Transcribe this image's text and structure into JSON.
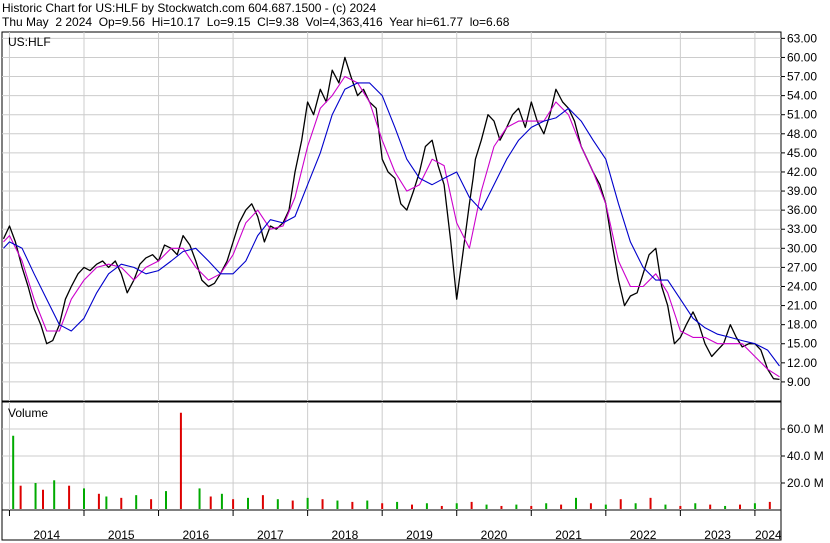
{
  "header": {
    "line1": "Historic Chart for US:HLF by Stockwatch.com 604.687.1500 - (c) 2024",
    "line2": "Thu May  2 2024  Op=9.56  Hi=10.17  Lo=9.15  Cl=9.38  Vol=4,363,416  Year hi=61.77  lo=6.68"
  },
  "colors": {
    "price": "#000000",
    "ma_short": "#cc00cc",
    "ma_long": "#0000cc",
    "vol_up": "#00aa00",
    "vol_down": "#dd0000",
    "grid": "#cccccc"
  },
  "chart_data": {
    "type": "line",
    "symbol_label": "US:HLF",
    "volume_label": "Volume",
    "x_ticks": [
      "2014",
      "2015",
      "2016",
      "2017",
      "2018",
      "2019",
      "2020",
      "2021",
      "2022",
      "2023",
      "2024"
    ],
    "price_axis": {
      "ylim": [
        6,
        64
      ],
      "ticks": [
        9,
        12,
        15,
        18,
        21,
        24,
        27,
        30,
        33,
        36,
        39,
        42,
        45,
        48,
        51,
        54,
        57,
        60,
        63
      ],
      "tick_labels": [
        "9.00",
        "12.00",
        "15.00",
        "18.00",
        "21.00",
        "24.00",
        "27.00",
        "30.00",
        "33.00",
        "36.00",
        "39.00",
        "42.00",
        "45.00",
        "48.00",
        "51.00",
        "54.00",
        "57.00",
        "60.00",
        "63.00"
      ]
    },
    "volume_axis": {
      "ylim": [
        0,
        80
      ],
      "ticks": [
        20,
        40,
        60
      ],
      "tick_labels": [
        "20.0 M",
        "40.0 M",
        "60.0 M"
      ]
    },
    "series": [
      {
        "name": "Close",
        "x": [
          2013.92,
          2014.0,
          2014.08,
          2014.17,
          2014.25,
          2014.33,
          2014.42,
          2014.5,
          2014.58,
          2014.67,
          2014.75,
          2014.83,
          2014.92,
          2015.0,
          2015.08,
          2015.17,
          2015.25,
          2015.33,
          2015.42,
          2015.5,
          2015.58,
          2015.67,
          2015.75,
          2015.83,
          2015.92,
          2016.0,
          2016.08,
          2016.17,
          2016.25,
          2016.33,
          2016.42,
          2016.5,
          2016.58,
          2016.67,
          2016.75,
          2016.83,
          2016.92,
          2017.0,
          2017.08,
          2017.17,
          2017.25,
          2017.33,
          2017.42,
          2017.5,
          2017.58,
          2017.67,
          2017.75,
          2017.83,
          2017.92,
          2018.0,
          2018.08,
          2018.17,
          2018.25,
          2018.33,
          2018.42,
          2018.5,
          2018.58,
          2018.67,
          2018.75,
          2018.83,
          2018.92,
          2019.0,
          2019.08,
          2019.17,
          2019.25,
          2019.33,
          2019.42,
          2019.5,
          2019.58,
          2019.67,
          2019.75,
          2019.83,
          2019.92,
          2020.0,
          2020.08,
          2020.17,
          2020.22,
          2020.25,
          2020.33,
          2020.42,
          2020.5,
          2020.58,
          2020.67,
          2020.75,
          2020.83,
          2020.92,
          2021.0,
          2021.08,
          2021.17,
          2021.25,
          2021.33,
          2021.42,
          2021.5,
          2021.58,
          2021.67,
          2021.75,
          2021.83,
          2021.92,
          2022.0,
          2022.08,
          2022.17,
          2022.25,
          2022.33,
          2022.42,
          2022.5,
          2022.58,
          2022.67,
          2022.75,
          2022.83,
          2022.92,
          2023.0,
          2023.08,
          2023.17,
          2023.25,
          2023.33,
          2023.42,
          2023.5,
          2023.58,
          2023.67,
          2023.75,
          2023.83,
          2023.92,
          2024.0,
          2024.08,
          2024.17,
          2024.25,
          2024.33
        ],
        "values": [
          31.5,
          33.5,
          31,
          27,
          24,
          20.5,
          18,
          15,
          15.5,
          18,
          22,
          24,
          26,
          27,
          26.5,
          27.5,
          28,
          27,
          28,
          26,
          23,
          25,
          27.5,
          28.5,
          29,
          28,
          30.5,
          30,
          29,
          32,
          30.5,
          28,
          25,
          24,
          24.5,
          26,
          28,
          31,
          34,
          36,
          37,
          35,
          31,
          33.5,
          33,
          34,
          36,
          42,
          47,
          53,
          51,
          55,
          53,
          58,
          56,
          60,
          57,
          54,
          55,
          53,
          52,
          44,
          42,
          41,
          37,
          36,
          39,
          42,
          46,
          47,
          43,
          40,
          31,
          22,
          29,
          37,
          41,
          44,
          47,
          51,
          50,
          47,
          49,
          51,
          52,
          49,
          53,
          50,
          48,
          51,
          55,
          53,
          52,
          50,
          46,
          44,
          42,
          40,
          37,
          31,
          25,
          21,
          22.5,
          23,
          26,
          29,
          30,
          24,
          21,
          15,
          16,
          18,
          20,
          18,
          15,
          13,
          14,
          15,
          18,
          16,
          14.5,
          15,
          15,
          14,
          11,
          9.5,
          9.4
        ]
      },
      {
        "name": "",
        "x": [
          2013.92,
          2014.0,
          2014.17,
          2014.33,
          2014.5,
          2014.67,
          2014.83,
          2015.0,
          2015.17,
          2015.33,
          2015.5,
          2015.67,
          2015.83,
          2016.0,
          2016.17,
          2016.33,
          2016.5,
          2016.67,
          2016.83,
          2017.0,
          2017.17,
          2017.33,
          2017.5,
          2017.67,
          2017.83,
          2018.0,
          2018.17,
          2018.33,
          2018.5,
          2018.67,
          2018.83,
          2019.0,
          2019.17,
          2019.33,
          2019.5,
          2019.67,
          2019.83,
          2020.0,
          2020.17,
          2020.33,
          2020.5,
          2020.67,
          2020.83,
          2021.0,
          2021.17,
          2021.33,
          2021.5,
          2021.67,
          2021.83,
          2022.0,
          2022.17,
          2022.33,
          2022.5,
          2022.67,
          2022.83,
          2023.0,
          2023.17,
          2023.33,
          2023.5,
          2023.67,
          2023.83,
          2024.0,
          2024.17,
          2024.33
        ],
        "values": [
          31,
          32,
          28,
          22,
          17,
          17,
          22,
          25,
          27,
          27.5,
          27,
          25,
          27,
          28,
          30,
          30,
          27,
          25,
          26,
          29,
          34,
          36,
          33,
          33.5,
          38,
          46,
          52,
          54,
          57,
          56,
          53,
          47,
          42,
          39,
          40,
          44,
          43,
          34,
          30,
          39,
          46,
          49,
          50,
          50,
          50,
          53,
          51,
          46,
          42,
          37,
          28,
          24,
          24,
          26,
          23,
          17,
          16,
          16,
          15,
          15,
          15,
          13,
          11,
          9.8
        ]
      },
      {
        "name": "",
        "x": [
          2013.92,
          2014.0,
          2014.17,
          2014.33,
          2014.5,
          2014.67,
          2014.83,
          2015.0,
          2015.17,
          2015.33,
          2015.5,
          2015.67,
          2015.83,
          2016.0,
          2016.17,
          2016.33,
          2016.5,
          2016.67,
          2016.83,
          2017.0,
          2017.17,
          2017.33,
          2017.5,
          2017.67,
          2017.83,
          2018.0,
          2018.17,
          2018.33,
          2018.5,
          2018.67,
          2018.83,
          2019.0,
          2019.17,
          2019.33,
          2019.5,
          2019.67,
          2019.83,
          2020.0,
          2020.17,
          2020.33,
          2020.5,
          2020.67,
          2020.83,
          2021.0,
          2021.17,
          2021.33,
          2021.5,
          2021.67,
          2021.83,
          2022.0,
          2022.17,
          2022.33,
          2022.5,
          2022.67,
          2022.83,
          2023.0,
          2023.17,
          2023.33,
          2023.5,
          2023.67,
          2023.83,
          2024.0,
          2024.17,
          2024.33
        ],
        "values": [
          30,
          31,
          30,
          26,
          22,
          18,
          17,
          19,
          23,
          26,
          27.5,
          27,
          26,
          26.5,
          28,
          29.5,
          30,
          28,
          26,
          26,
          28,
          32,
          34.5,
          34,
          35,
          40,
          45,
          51,
          55,
          56,
          56,
          54,
          49,
          44,
          41,
          40,
          41,
          42,
          38,
          36,
          40,
          44,
          47,
          49,
          50,
          50.5,
          52,
          50,
          47,
          44,
          37,
          31,
          27,
          25,
          25,
          22,
          19,
          17.5,
          16.5,
          16,
          15.5,
          15,
          14,
          11.5
        ]
      }
    ],
    "volume": {
      "x": [
        2014.05,
        2014.15,
        2014.35,
        2014.45,
        2014.6,
        2014.8,
        2015.0,
        2015.2,
        2015.3,
        2015.5,
        2015.7,
        2015.9,
        2016.1,
        2016.3,
        2016.55,
        2016.7,
        2016.85,
        2017.0,
        2017.2,
        2017.4,
        2017.6,
        2017.8,
        2018.0,
        2018.2,
        2018.4,
        2018.6,
        2018.8,
        2019.0,
        2019.2,
        2019.4,
        2019.6,
        2019.8,
        2020.0,
        2020.2,
        2020.4,
        2020.6,
        2020.8,
        2021.0,
        2021.2,
        2021.4,
        2021.6,
        2021.8,
        2022.0,
        2022.2,
        2022.4,
        2022.6,
        2022.8,
        2023.0,
        2023.2,
        2023.4,
        2023.6,
        2023.8,
        2024.0,
        2024.2
      ],
      "values": [
        55,
        18,
        20,
        15,
        22,
        18,
        16,
        12,
        10,
        9,
        11,
        8,
        14,
        72,
        16,
        10,
        12,
        8,
        9,
        11,
        8,
        7,
        9,
        8,
        7,
        6,
        7,
        5,
        6,
        4,
        5,
        3,
        5,
        6,
        4,
        3,
        4,
        3,
        5,
        4,
        9,
        5,
        4,
        8,
        5,
        9,
        4,
        3,
        5,
        4,
        3,
        4,
        5,
        6
      ]
    }
  }
}
